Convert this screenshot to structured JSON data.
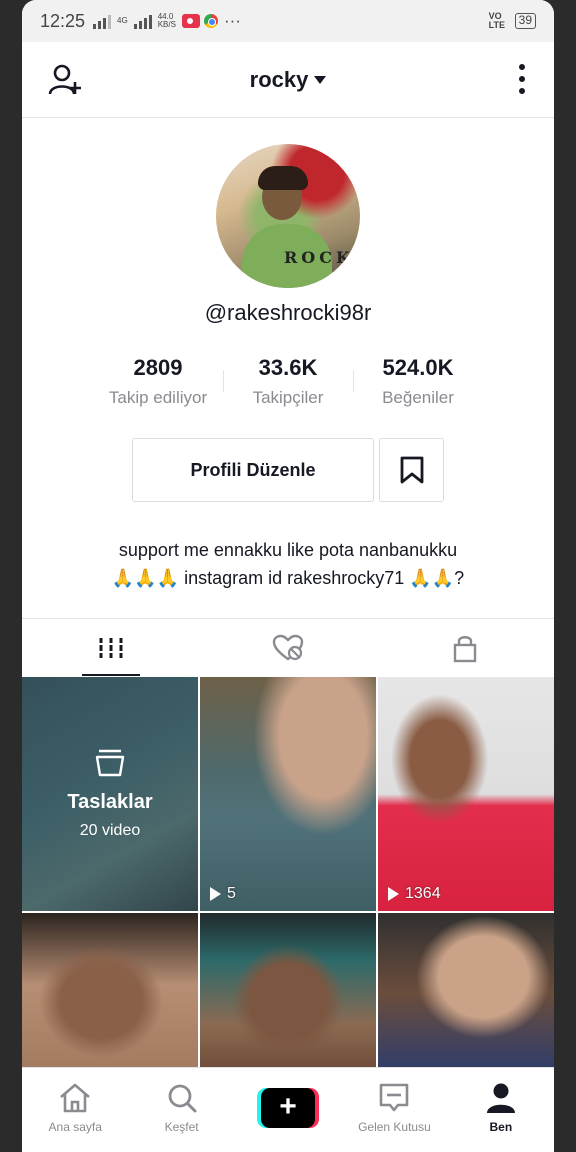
{
  "status_bar": {
    "time": "12:25",
    "net_speed_value": "44.0",
    "net_speed_unit": "KB/S",
    "net_type": "4G",
    "more": "···",
    "volte": "VO LTE",
    "battery": "39"
  },
  "header": {
    "username": "rocky",
    "add_user_icon": "add-user-icon",
    "more_icon": "vertical-dots-icon"
  },
  "profile": {
    "avatar_text": "ROCK",
    "handle": "@rakeshrocki98r",
    "stats": [
      {
        "value": "2809",
        "label": "Takip ediliyor"
      },
      {
        "value": "33.6K",
        "label": "Takipçiler"
      },
      {
        "value": "524.0K",
        "label": "Beğeniler"
      }
    ],
    "edit_label": "Profili Düzenle",
    "bio_line1": "support me ennakku like pota nanbanukku",
    "bio_line2": "🙏🙏🙏 instagram id rakeshrocky71  🙏🙏?"
  },
  "tabs": [
    {
      "icon": "grid-icon",
      "active": true
    },
    {
      "icon": "liked-hidden-icon",
      "active": false
    },
    {
      "icon": "lock-icon",
      "active": false
    }
  ],
  "grid": {
    "drafts_title": "Taslaklar",
    "drafts_count": "20 video",
    "videos": [
      {
        "views": "5"
      },
      {
        "views": "1364"
      }
    ]
  },
  "bottom_nav": {
    "home": "Ana sayfa",
    "discover": "Keşfet",
    "create": "+",
    "inbox": "Gelen Kutusu",
    "me": "Ben"
  },
  "colors": {
    "accent_cyan": "#25f4ee",
    "accent_pink": "#fe2c55",
    "text_primary": "#161823",
    "text_secondary": "#8a8b91"
  }
}
